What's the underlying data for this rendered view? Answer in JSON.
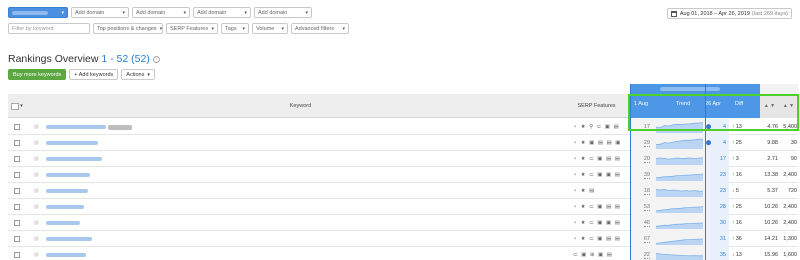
{
  "filters": {
    "domains": [
      {
        "label": "",
        "active": true
      },
      {
        "label": "Add domain",
        "active": false
      },
      {
        "label": "Add domain",
        "active": false
      },
      {
        "label": "Add domain",
        "active": false
      },
      {
        "label": "Add domain",
        "active": false
      }
    ],
    "keyword_placeholder": "Filter by keyword",
    "dropdowns": [
      "Top positions & changes",
      "SERP Features",
      "Tags",
      "Volume",
      "Advanced filters"
    ],
    "date_range": "Aug 01, 2018 – Apr 26, 2019",
    "date_days": "(last 269 days)"
  },
  "title": {
    "text": "Rankings Overview",
    "range": "1 - 52 (52)",
    "info": "?"
  },
  "actions": {
    "buy": "Buy more keywords",
    "add": "+ Add keywords",
    "actions": "Actions"
  },
  "table": {
    "headers": {
      "keyword": "Keyword",
      "serp": "SERP Features",
      "date1": "1 Aug",
      "trend": "Trend",
      "date2": "26 Apr",
      "diff": "Diff",
      "sort": "▲ ▼"
    },
    "rows": [
      {
        "serp": "♀ ★ ⚲ ⊂ ▣ ▤",
        "pos1": "17",
        "pos2": "4",
        "pin": true,
        "dir": "up",
        "diff": "13",
        "r1": "4.76",
        "r2": "5,400",
        "trend": [
          0.55,
          0.6,
          0.4,
          0.45,
          0.35,
          0.3,
          0.32,
          0.28,
          0.25,
          0.2,
          0.18,
          0.15
        ]
      },
      {
        "serp": "♀ ★ ▣ ▤ ▤ ▣",
        "pos1": "29",
        "pos2": "4",
        "pin": true,
        "dir": "up",
        "diff": "25",
        "r1": "9.88",
        "r2": "30",
        "trend": [
          0.7,
          0.65,
          0.5,
          0.55,
          0.45,
          0.4,
          0.35,
          0.3,
          0.3,
          0.25,
          0.2,
          0.2
        ]
      },
      {
        "serp": "♀ ★ ⊂ ▣ ▤ ▤",
        "pos1": "20",
        "pos2": "17",
        "pin": false,
        "dir": "up",
        "diff": "3",
        "r1": "2.71",
        "r2": "90",
        "trend": [
          0.5,
          0.45,
          0.5,
          0.55,
          0.5,
          0.45,
          0.5,
          0.48,
          0.45,
          0.5,
          0.46,
          0.44
        ]
      },
      {
        "serp": "♀ ★ ⊂ ▣ ▣ ▤",
        "pos1": "39",
        "pos2": "23",
        "pin": false,
        "dir": "up",
        "diff": "16",
        "r1": "13.38",
        "r2": "2,400",
        "trend": [
          0.8,
          0.75,
          0.7,
          0.7,
          0.65,
          0.6,
          0.6,
          0.55,
          0.55,
          0.5,
          0.5,
          0.45
        ]
      },
      {
        "serp": "♀ ★ ▤",
        "pos1": "18",
        "pos2": "23",
        "pin": false,
        "dir": "down",
        "diff": "5",
        "r1": "5.37",
        "r2": "720",
        "trend": [
          0.4,
          0.45,
          0.4,
          0.5,
          0.45,
          0.5,
          0.55,
          0.5,
          0.55,
          0.5,
          0.55,
          0.55
        ]
      },
      {
        "serp": "♀ ★ ⊂ ▣ ▤ ▤",
        "pos1": "53",
        "pos2": "28",
        "pin": false,
        "dir": "up",
        "diff": "25",
        "r1": "10.26",
        "r2": "2,400",
        "trend": [
          0.9,
          0.85,
          0.8,
          0.75,
          0.7,
          0.7,
          0.65,
          0.6,
          0.6,
          0.55,
          0.55,
          0.5
        ]
      },
      {
        "serp": "♀ ★ ⊂ ▣ ▣ ▤",
        "pos1": "46",
        "pos2": "30",
        "pin": false,
        "dir": "up",
        "diff": "16",
        "r1": "10.26",
        "r2": "2,400",
        "trend": [
          0.85,
          0.8,
          0.75,
          0.75,
          0.7,
          0.65,
          0.65,
          0.6,
          0.6,
          0.58,
          0.55,
          0.55
        ]
      },
      {
        "serp": "♀ ★ ⊂ ▣ ▤ ▤",
        "pos1": "67",
        "pos2": "31",
        "pin": false,
        "dir": "up",
        "diff": "36",
        "r1": "14.21",
        "r2": "1,300",
        "trend": [
          0.95,
          0.9,
          0.85,
          0.8,
          0.75,
          0.7,
          0.65,
          0.6,
          0.6,
          0.58,
          0.55,
          0.55
        ]
      },
      {
        "serp": "⊂ ▣ ⊕ ▣ ▤",
        "pos1": "22",
        "pos2": "35",
        "pin": false,
        "dir": "down",
        "diff": "13",
        "r1": "15.96",
        "r2": "1,600",
        "trend": [
          0.4,
          0.45,
          0.5,
          0.5,
          0.55,
          0.55,
          0.6,
          0.6,
          0.62,
          0.6,
          0.62,
          0.62
        ]
      }
    ]
  },
  "colors": {
    "accent_blue": "#4e97e6",
    "link_blue": "#2d7bd2",
    "green_button": "#5aa83f",
    "highlight_green": "#4cd12b",
    "up": "#3b9e2a",
    "down": "#d9381e"
  }
}
